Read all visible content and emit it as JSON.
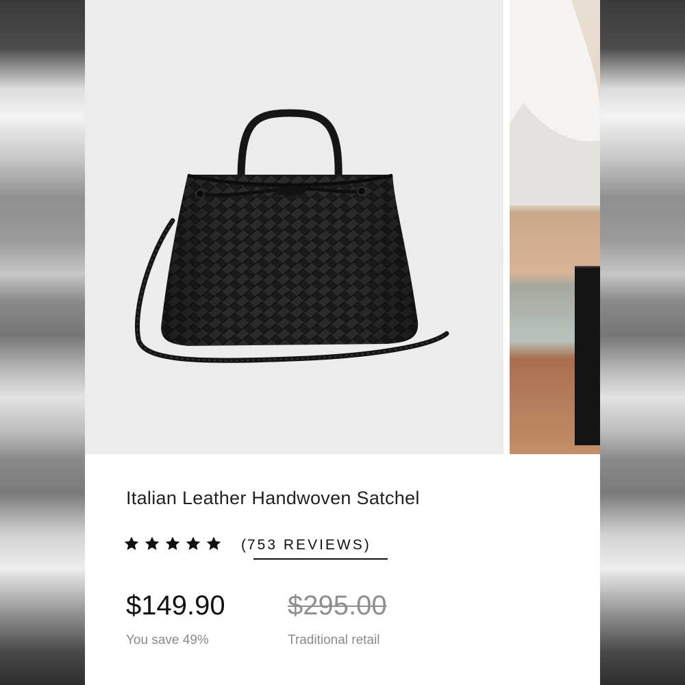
{
  "product": {
    "title": "Italian Leather Handwoven Satchel",
    "rating": {
      "stars": 5,
      "max_stars": 5,
      "reviews_count": "753",
      "reviews_word": "REVIEWS",
      "star_color": "#111111"
    },
    "price": "$149.90",
    "savings_text": "You save 49%",
    "retail_price": "$295.00",
    "retail_label": "Traditional retail"
  },
  "gallery": {
    "images": [
      {
        "subject": "black woven leather satchel with top handle and braided shoulder strap",
        "background": "#ececed"
      },
      {
        "subject": "person in white shirt seated holding black woven bag",
        "background": "#e6d8c8"
      }
    ]
  },
  "colors": {
    "card_background": "#ffffff",
    "text_primary": "#222222",
    "text_muted": "#8a8a8a"
  }
}
